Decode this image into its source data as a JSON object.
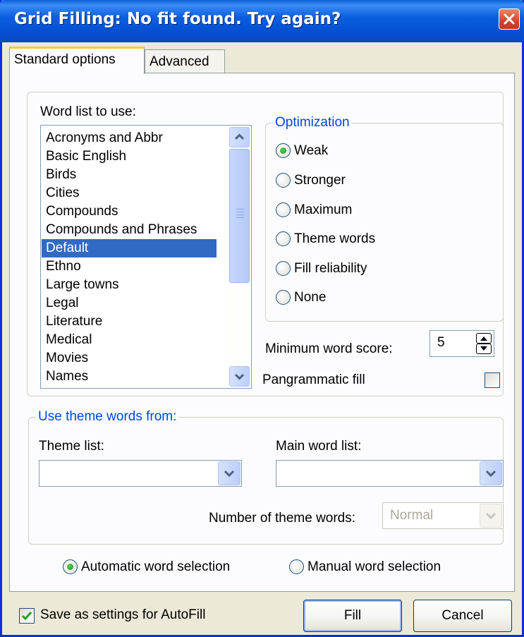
{
  "window": {
    "title": "Grid Filling: No fit found. Try again?"
  },
  "tabs": [
    {
      "label": "Standard options"
    },
    {
      "label": "Advanced"
    }
  ],
  "word_list": {
    "label": "Word list to use:",
    "items": [
      "Acronyms and Abbr",
      "Basic English",
      "Birds",
      "Cities",
      "Compounds",
      "Compounds and Phrases",
      "Default",
      "Ethno",
      "Large towns",
      "Legal",
      "Literature",
      "Medical",
      "Movies",
      "Names"
    ],
    "selected": "Default"
  },
  "optimization": {
    "title": "Optimization",
    "options": [
      "Weak",
      "Stronger",
      "Maximum",
      "Theme words",
      "Fill reliability",
      "None"
    ],
    "selected": "Weak"
  },
  "min_word_score": {
    "label": "Minimum word score:",
    "value": "5"
  },
  "pangrammatic": {
    "label": "Pangrammatic fill",
    "checked": false
  },
  "theme": {
    "title": "Use theme words from:",
    "theme_list_label": "Theme list:",
    "theme_list_value": "",
    "main_list_label": "Main word list:",
    "main_list_value": "",
    "number_label": "Number of theme words:",
    "number_value": "Normal"
  },
  "selection_mode": {
    "automatic": "Automatic word selection",
    "manual": "Manual word selection",
    "selected": "automatic"
  },
  "footer": {
    "save_label": "Save as settings for AutoFill",
    "save_checked": true,
    "fill_label": "Fill",
    "cancel_label": "Cancel"
  },
  "colors": {
    "title_bar": "#0b5fe0",
    "selection": "#316ac5",
    "group_title": "#0046d5",
    "active_tab_accent": "#ffc83c",
    "face": "#ece9d8"
  }
}
